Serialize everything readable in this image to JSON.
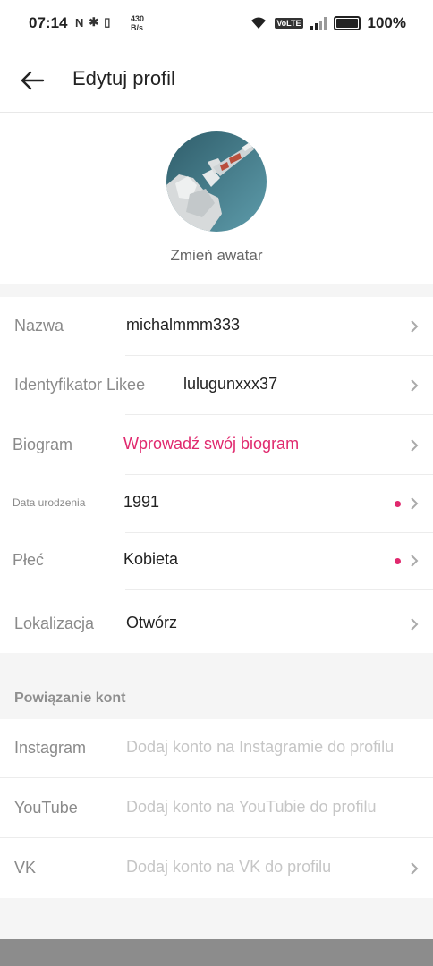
{
  "status_bar": {
    "time": "07:14",
    "speed_value": "430",
    "speed_unit": "B/s",
    "network": "VoLTE",
    "battery": "100%"
  },
  "header": {
    "title": "Edytuj profil"
  },
  "avatar": {
    "change_label": "Zmień awatar"
  },
  "profile": {
    "name": {
      "label": "Nazwa",
      "value": "michalmmm333"
    },
    "likee_id": {
      "label": "Identyfikator Likee",
      "value": "lulugunxxx37"
    },
    "bio": {
      "label": "Biogram",
      "placeholder": "Wprowadź swój biogram"
    },
    "birthdate": {
      "label": "Data urodzenia",
      "value": "1991"
    },
    "gender": {
      "label": "Płeć",
      "value": "Kobieta"
    },
    "location": {
      "label": "Lokalizacja",
      "value": "Otwórz"
    }
  },
  "linked_accounts": {
    "title": "Powiązanie kont",
    "instagram": {
      "label": "Instagram",
      "placeholder": "Dodaj konto na Instagramie do profilu"
    },
    "youtube": {
      "label": "YouTube",
      "placeholder": "Dodaj konto na YouTubie do profilu"
    },
    "vk": {
      "label": "VK",
      "placeholder": "Dodaj konto na VK do profilu"
    }
  },
  "colors": {
    "accent": "#e0296e",
    "label_gray": "#8a8a8a",
    "background": "#f5f5f5"
  }
}
